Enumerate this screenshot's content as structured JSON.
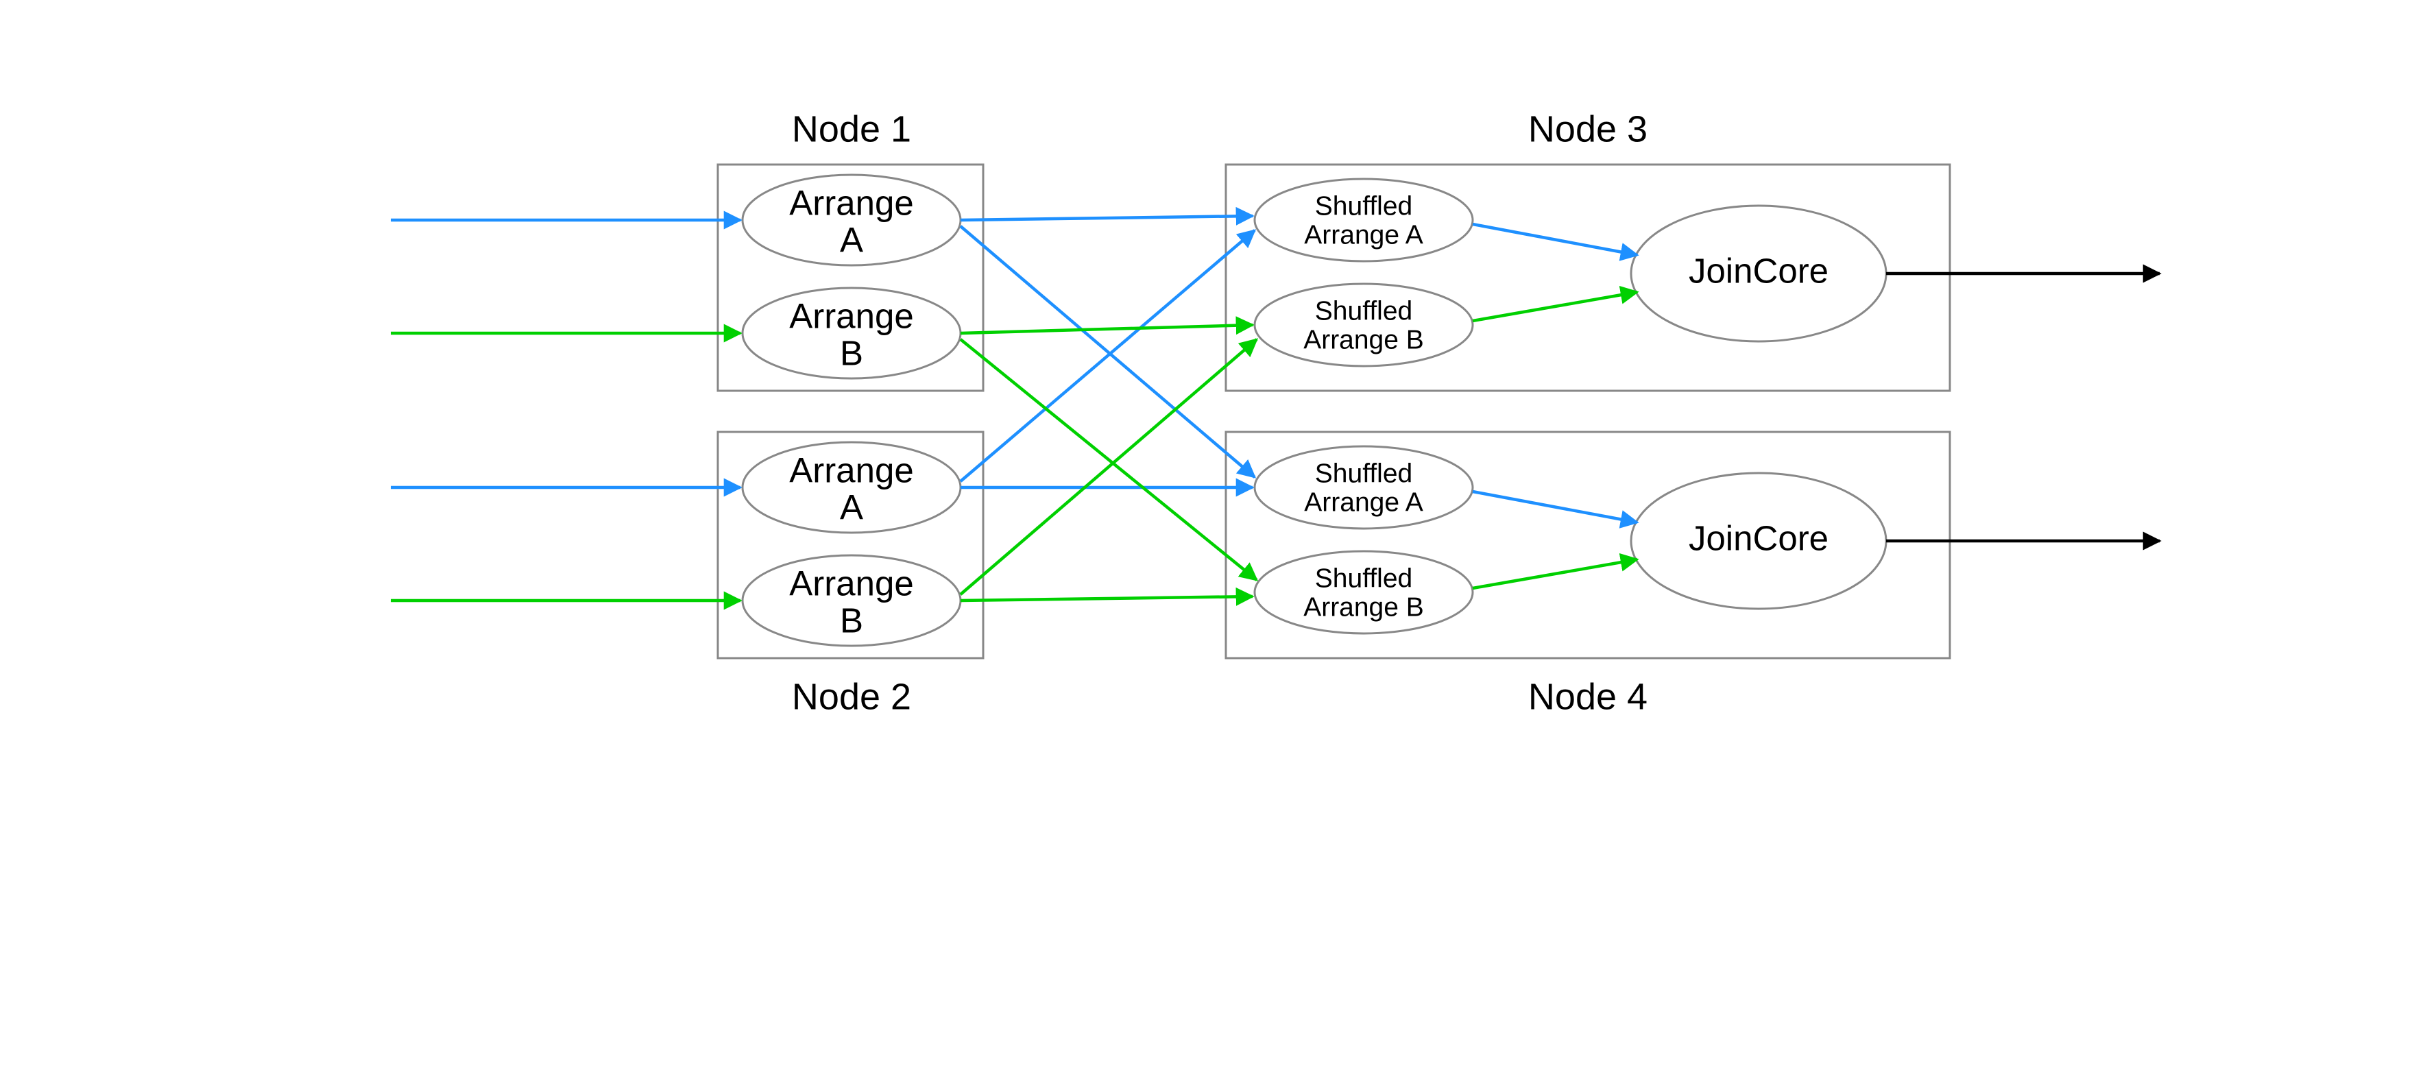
{
  "colors": {
    "blue": "#1e90ff",
    "green": "#00d000",
    "black": "#000000",
    "box": "#888888"
  },
  "nodes": {
    "n1": {
      "title": "Node 1",
      "a": "Arrange\nA",
      "b": "Arrange\nB"
    },
    "n2": {
      "title": "Node 2",
      "a": "Arrange\nA",
      "b": "Arrange\nB"
    },
    "n3": {
      "title": "Node 3",
      "sa": "Shuffled\nArrange A",
      "sb": "Shuffled\nArrange B",
      "join": "JoinCore"
    },
    "n4": {
      "title": "Node 4",
      "sa": "Shuffled\nArrange A",
      "sb": "Shuffled\nArrange B",
      "join": "JoinCore"
    }
  },
  "diagram": {
    "type": "dataflow",
    "inputs": [
      {
        "stream": "A",
        "color": "blue",
        "to": "Node 1"
      },
      {
        "stream": "B",
        "color": "green",
        "to": "Node 1"
      },
      {
        "stream": "A",
        "color": "blue",
        "to": "Node 2"
      },
      {
        "stream": "B",
        "color": "green",
        "to": "Node 2"
      }
    ],
    "shuffle_edges": [
      {
        "stream": "A",
        "from": "Node 1",
        "to": "Node 3"
      },
      {
        "stream": "A",
        "from": "Node 1",
        "to": "Node 4"
      },
      {
        "stream": "A",
        "from": "Node 2",
        "to": "Node 3"
      },
      {
        "stream": "A",
        "from": "Node 2",
        "to": "Node 4"
      },
      {
        "stream": "B",
        "from": "Node 1",
        "to": "Node 3"
      },
      {
        "stream": "B",
        "from": "Node 1",
        "to": "Node 4"
      },
      {
        "stream": "B",
        "from": "Node 2",
        "to": "Node 3"
      },
      {
        "stream": "B",
        "from": "Node 2",
        "to": "Node 4"
      }
    ],
    "join_inputs": [
      {
        "node": "Node 3",
        "from": "Shuffled Arrange A",
        "to": "JoinCore",
        "color": "blue"
      },
      {
        "node": "Node 3",
        "from": "Shuffled Arrange B",
        "to": "JoinCore",
        "color": "green"
      },
      {
        "node": "Node 4",
        "from": "Shuffled Arrange A",
        "to": "JoinCore",
        "color": "blue"
      },
      {
        "node": "Node 4",
        "from": "Shuffled Arrange B",
        "to": "JoinCore",
        "color": "green"
      }
    ],
    "outputs": [
      {
        "from": "Node 3 JoinCore",
        "color": "black"
      },
      {
        "from": "Node 4 JoinCore",
        "color": "black"
      }
    ]
  }
}
